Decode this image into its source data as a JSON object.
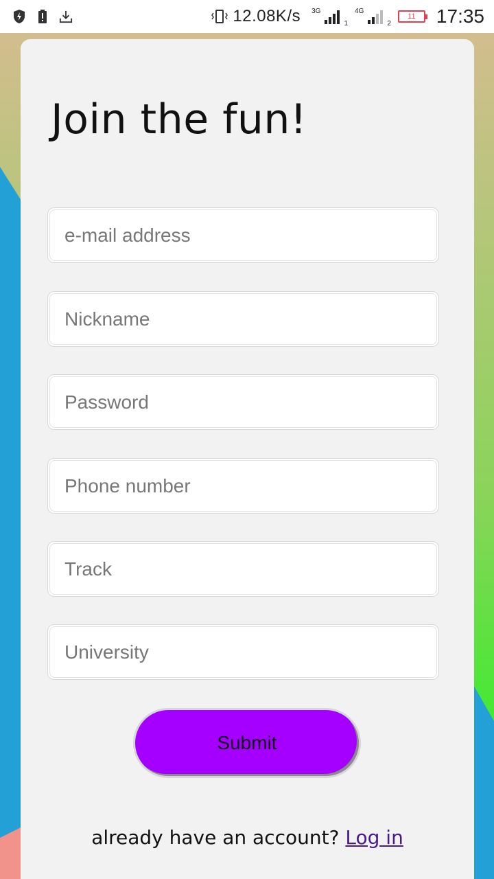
{
  "status_bar": {
    "net_speed": "12.08K/s",
    "sim1_type": "3G",
    "sim1_num": "1",
    "sim2_type": "4G",
    "sim2_num": "2",
    "battery": "11",
    "time": "17:35",
    "icons": [
      "shield-icon",
      "battery-alert-icon",
      "download-icon",
      "vibrate-icon"
    ]
  },
  "form": {
    "title": "Join the fun!",
    "fields": [
      {
        "placeholder": "e-mail address",
        "value": ""
      },
      {
        "placeholder": "Nickname",
        "value": ""
      },
      {
        "placeholder": "Password",
        "value": ""
      },
      {
        "placeholder": "Phone number",
        "value": ""
      },
      {
        "placeholder": "Track",
        "value": ""
      },
      {
        "placeholder": "University",
        "value": ""
      }
    ],
    "submit_label": "Submit",
    "footer_text": "already have an account?",
    "login_link": "Log in"
  },
  "colors": {
    "accent": "#a500ff",
    "link": "#4b1a8a",
    "card_bg": "#f2f2f2",
    "bg_blue": "#23a0d6",
    "bg_green": "#47e834"
  }
}
